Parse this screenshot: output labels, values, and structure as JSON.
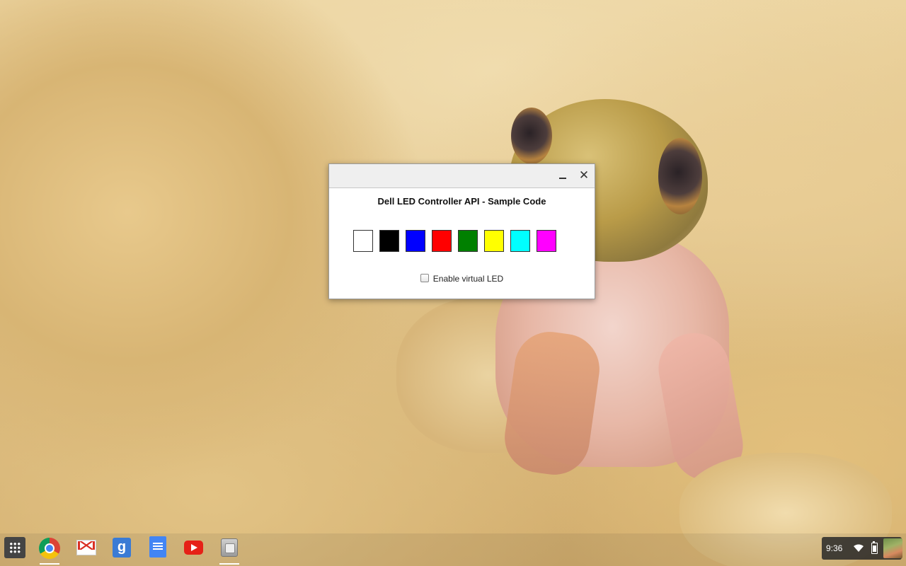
{
  "window": {
    "title": "Dell LED Controller API - Sample Code",
    "minimize_label": "",
    "close_label": "✕"
  },
  "swatches": [
    {
      "name": "white",
      "color": "#ffffff"
    },
    {
      "name": "black",
      "color": "#000000"
    },
    {
      "name": "blue",
      "color": "#0000ff"
    },
    {
      "name": "red",
      "color": "#ff0000"
    },
    {
      "name": "green",
      "color": "#008000"
    },
    {
      "name": "yellow",
      "color": "#ffff00"
    },
    {
      "name": "cyan",
      "color": "#00ffff"
    },
    {
      "name": "magenta",
      "color": "#ff00ff"
    }
  ],
  "virtual_led": {
    "label": "Enable virtual LED",
    "checked": false
  },
  "shelf": {
    "apps": [
      {
        "name": "launcher",
        "icon": "app-launcher-icon"
      },
      {
        "name": "chrome",
        "icon": "chrome-icon"
      },
      {
        "name": "gmail",
        "icon": "gmail-icon"
      },
      {
        "name": "google-search",
        "icon": "google-search-icon",
        "glyph": "g"
      },
      {
        "name": "docs",
        "icon": "docs-icon"
      },
      {
        "name": "youtube",
        "icon": "youtube-icon"
      },
      {
        "name": "app",
        "icon": "app-icon"
      }
    ],
    "status": {
      "time": "9:36",
      "wifi": "wifi-icon",
      "battery": "battery-icon"
    }
  }
}
